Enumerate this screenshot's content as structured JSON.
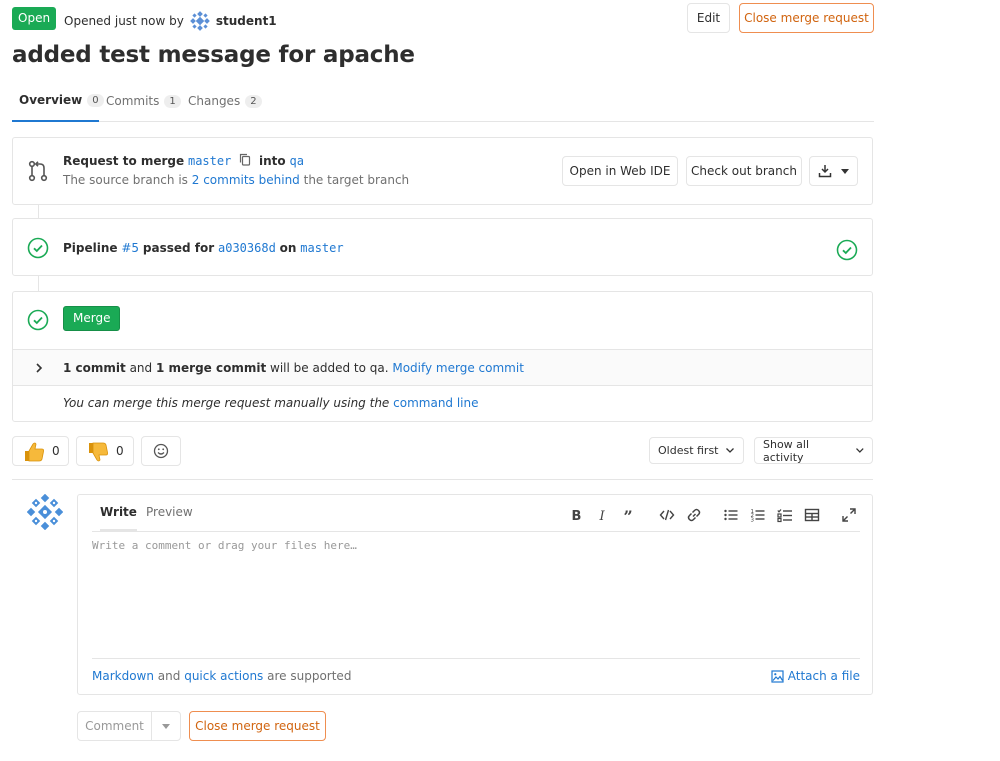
{
  "header": {
    "status_badge": "Open",
    "opened_prefix": "Opened just now by",
    "author": "student1",
    "edit_label": "Edit",
    "close_label": "Close merge request"
  },
  "title": "added test message for apache",
  "tabs": [
    {
      "label": "Overview",
      "count": "0"
    },
    {
      "label": "Commits",
      "count": "1"
    },
    {
      "label": "Changes",
      "count": "2"
    }
  ],
  "mr_widget": {
    "request_prefix": "Request to merge",
    "source_branch": "master",
    "into_label": "into",
    "target_branch": "qa",
    "behind_prefix": "The source branch is",
    "behind_link": "2 commits behind",
    "behind_suffix": "the target branch",
    "web_ide_label": "Open in Web IDE",
    "checkout_label": "Check out branch"
  },
  "pipeline": {
    "prefix": "Pipeline",
    "id": "#5",
    "passed_for": "passed for",
    "sha": "a030368d",
    "on_label": "on",
    "branch": "master"
  },
  "merge": {
    "button_label": "Merge",
    "commit_count": "1 commit",
    "and_label": "and",
    "merge_commit": "1 merge commit",
    "added_to": "will be added to qa.",
    "modify_link": "Modify merge commit",
    "manual_text": "You can merge this merge request manually using the",
    "command_line": "command line"
  },
  "reactions": {
    "thumbs_up_count": "0",
    "thumbs_down_count": "0"
  },
  "filters": {
    "sort_label": "Oldest first",
    "activity_label": "Show all activity"
  },
  "editor": {
    "write_tab": "Write",
    "preview_tab": "Preview",
    "placeholder": "Write a comment or drag your files here…",
    "markdown_link": "Markdown",
    "and_label": "and",
    "quick_actions_link": "quick actions",
    "supported_label": "are supported",
    "attach_label": "Attach a file"
  },
  "footer": {
    "comment_label": "Comment",
    "close_label": "Close merge request"
  },
  "colors": {
    "success": "#1aaa55",
    "link": "#1f78d1",
    "warning": "#d1640f",
    "border": "#e5e5e5"
  }
}
